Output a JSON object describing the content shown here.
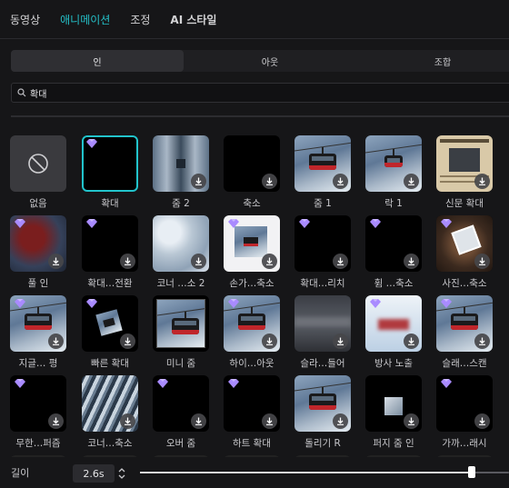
{
  "top_tabs": [
    {
      "label": "동영상",
      "active": false
    },
    {
      "label": "애니메이션",
      "active": true
    },
    {
      "label": "조정",
      "active": false
    },
    {
      "label": "AI 스타일",
      "active": false
    }
  ],
  "segment_tabs": [
    {
      "label": "인",
      "active": true
    },
    {
      "label": "아웃",
      "active": false
    },
    {
      "label": "조합",
      "active": false
    }
  ],
  "search": {
    "value": "확대",
    "icon": "search-icon"
  },
  "effects": [
    {
      "label": "없음",
      "type": "none",
      "premium": false,
      "download": false,
      "scene": "none"
    },
    {
      "label": "확대",
      "type": "effect",
      "premium": true,
      "download": false,
      "scene": "black",
      "selected": true
    },
    {
      "label": "줌 2",
      "type": "effect",
      "premium": false,
      "download": true,
      "scene": "mirror"
    },
    {
      "label": "축소",
      "type": "effect",
      "premium": false,
      "download": true,
      "scene": "black"
    },
    {
      "label": "줌 1",
      "type": "effect",
      "premium": false,
      "download": true,
      "scene": "gondola"
    },
    {
      "label": "락 1",
      "type": "effect",
      "premium": false,
      "download": true,
      "scene": "gondola-small"
    },
    {
      "label": "신문 확대",
      "type": "effect",
      "premium": false,
      "download": true,
      "scene": "paper"
    },
    {
      "label": "풀 인",
      "type": "effect",
      "premium": true,
      "download": true,
      "scene": "reddark"
    },
    {
      "label": "확대…전환",
      "type": "effect",
      "premium": true,
      "download": true,
      "scene": "black"
    },
    {
      "label": "코너 …소 2",
      "type": "effect",
      "premium": false,
      "download": true,
      "scene": "snow"
    },
    {
      "label": "손가…축소",
      "type": "effect",
      "premium": true,
      "download": true,
      "scene": "card"
    },
    {
      "label": "확대…리치",
      "type": "effect",
      "premium": true,
      "download": true,
      "scene": "black"
    },
    {
      "label": "휨 …축소",
      "type": "effect",
      "premium": true,
      "download": true,
      "scene": "black"
    },
    {
      "label": "사진…축소",
      "type": "effect",
      "premium": true,
      "download": true,
      "scene": "wood"
    },
    {
      "label": "지글… 평",
      "type": "effect",
      "premium": true,
      "download": true,
      "scene": "gondola"
    },
    {
      "label": "빠른 확대",
      "type": "effect",
      "premium": true,
      "download": true,
      "scene": "tilted"
    },
    {
      "label": "미니 줌",
      "type": "effect",
      "premium": false,
      "download": false,
      "scene": "framed"
    },
    {
      "label": "하이…아웃",
      "type": "effect",
      "premium": true,
      "download": true,
      "scene": "gondola"
    },
    {
      "label": "슬라…들어",
      "type": "effect",
      "premium": false,
      "download": true,
      "scene": "blurred"
    },
    {
      "label": "방사 노출",
      "type": "effect",
      "premium": true,
      "download": true,
      "scene": "bright"
    },
    {
      "label": "슬래…스캔",
      "type": "effect",
      "premium": true,
      "download": true,
      "scene": "gondola"
    },
    {
      "label": "무한…퍼즘",
      "type": "effect",
      "premium": true,
      "download": true,
      "scene": "black"
    },
    {
      "label": "코너…축소",
      "type": "effect",
      "premium": false,
      "download": true,
      "scene": "tree"
    },
    {
      "label": "오버 줌",
      "type": "effect",
      "premium": true,
      "download": true,
      "scene": "black"
    },
    {
      "label": "하트 확대",
      "type": "effect",
      "premium": true,
      "download": true,
      "scene": "black"
    },
    {
      "label": "돌리기 R",
      "type": "effect",
      "premium": false,
      "download": true,
      "scene": "gondola"
    },
    {
      "label": "퍼지 줌 인",
      "type": "effect",
      "premium": false,
      "download": true,
      "scene": "smallsquare"
    },
    {
      "label": "가까…래시",
      "type": "effect",
      "premium": true,
      "download": true,
      "scene": "black"
    }
  ],
  "duration": {
    "label": "길이",
    "value": "2.6s",
    "fraction": 0.9
  },
  "colors": {
    "accent": "#24c0c8",
    "premium": "#a98bff",
    "background": "#161618"
  }
}
